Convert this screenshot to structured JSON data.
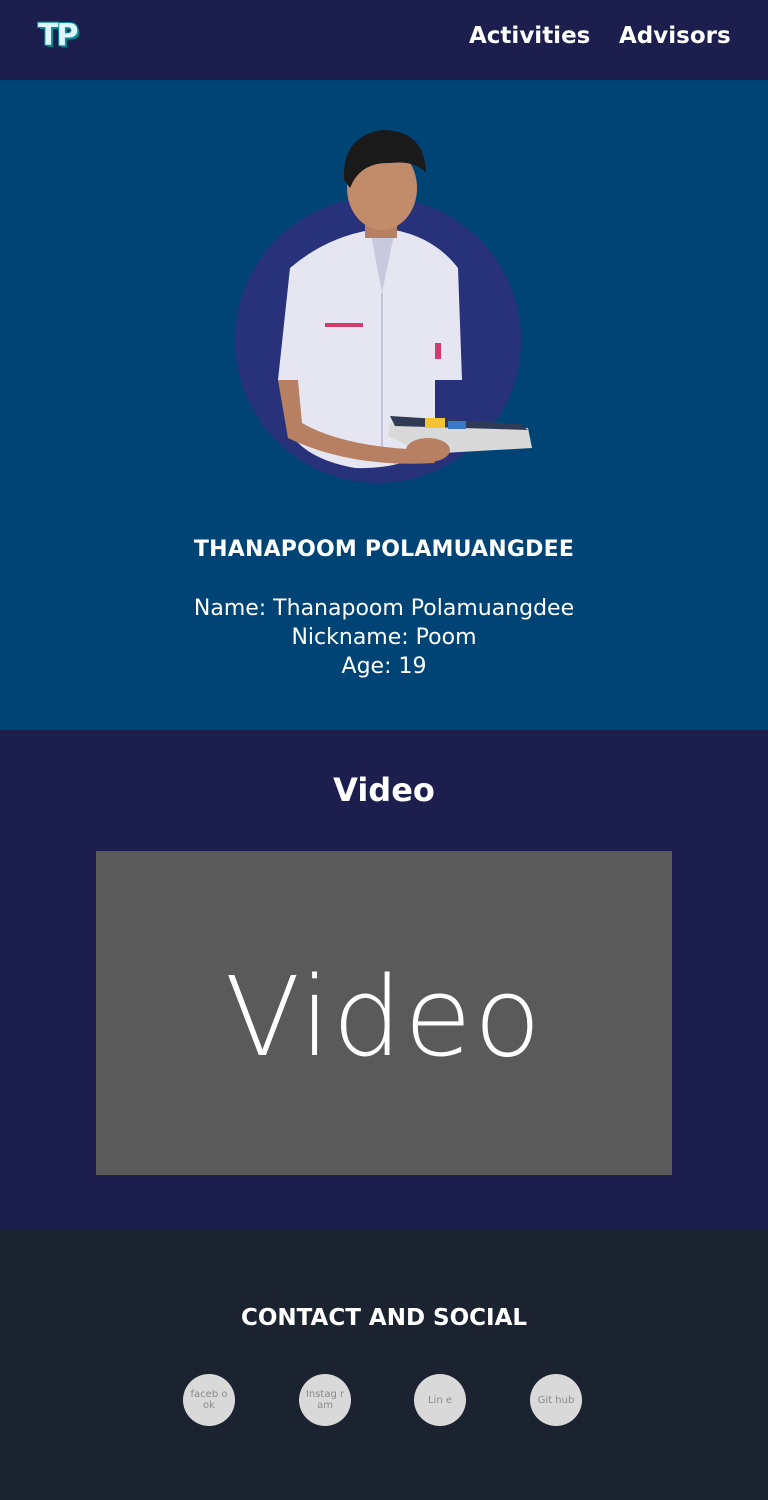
{
  "navbar": {
    "logo_text": "TP",
    "links": [
      {
        "label": "Activities"
      },
      {
        "label": "Advisors"
      }
    ]
  },
  "hero": {
    "display_name": "THANAPOOM POLAMUANGDEE",
    "info": {
      "name": "Name: Thanapoom Polamuangdee",
      "nickname": "Nickname: Poom",
      "age": "Age: 19"
    }
  },
  "video": {
    "heading": "Video",
    "placeholder": "Video"
  },
  "footer": {
    "heading": "CONTACT AND SOCIAL",
    "socials": [
      {
        "label": "faceb ook"
      },
      {
        "label": "Instag ram"
      },
      {
        "label": "Lin e"
      },
      {
        "label": "Git hub"
      }
    ]
  },
  "colors": {
    "navbar_bg": "#1c1f4d",
    "hero_bg": "#004476",
    "portrait_circle": "#27327a",
    "video_section_bg": "#1c1f4d",
    "video_box_bg": "#5a5a5a",
    "footer_bg": "#1b2230",
    "social_circle": "#d9d9d9"
  }
}
